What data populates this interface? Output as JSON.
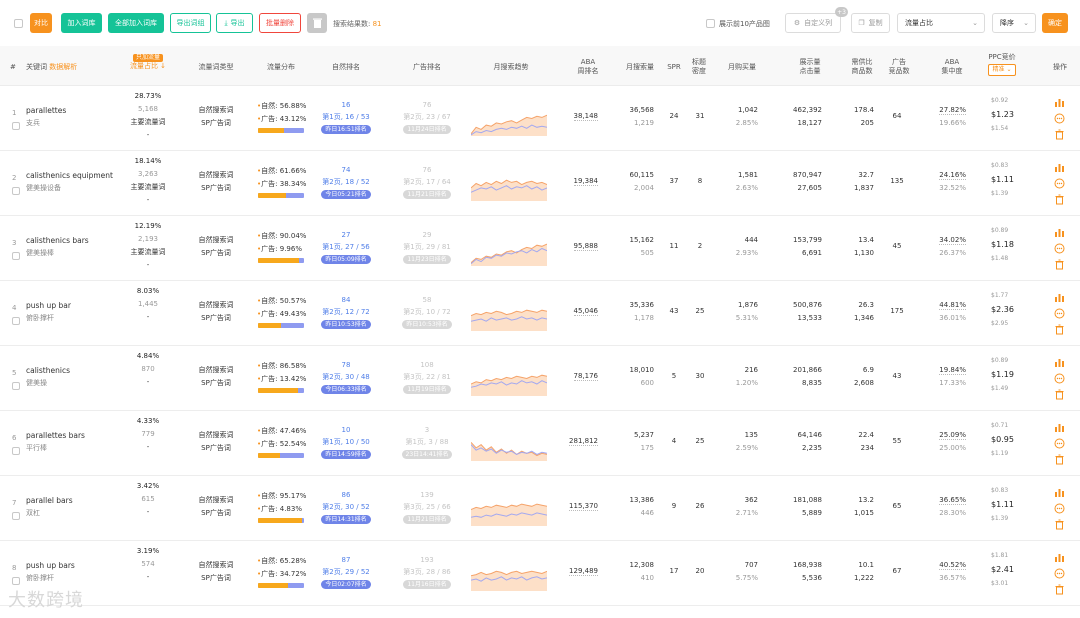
{
  "toolbar": {
    "compare": "对比",
    "add_lib": "加入词库",
    "add_all": "全部加入词库",
    "export_kw": "导出词组",
    "export": "导出",
    "batch_delete": "批量删除",
    "result_label": "搜索结果数:",
    "result_count": "81",
    "show_top10": "展示前10产品图",
    "custom_col": "自定义列",
    "custom_col_badge": "+3",
    "copy": "复制",
    "sort_field": "流量占比",
    "sort_order": "降序",
    "confirm": "确定"
  },
  "header": {
    "index": "#",
    "keyword": "关键词",
    "data_interpret": "数据解析",
    "traffic_share_tag": "只加流量",
    "traffic_share": "流量占比 ↓",
    "word_type": "流量词类型",
    "dist": "流量分布",
    "organic_rank": "自然排名",
    "ad_rank": "广告排名",
    "trend": "月搜索趋势",
    "aba1": "ABA",
    "aba2": "周排名",
    "monthly_search": "月搜索量",
    "spr": "SPR",
    "title_density1": "标题",
    "title_density2": "密度",
    "monthly_buy": "月购买量",
    "impressions1": "展示量",
    "impressions2": "点击量",
    "supply1": "需供比",
    "supply2": "商品数",
    "ad_products1": "广告",
    "ad_products2": "竞品数",
    "aba_conc1": "ABA",
    "aba_conc2": "集中度",
    "ppc": "PPC竞价",
    "ppc_sort": "精准",
    "actions": "操作"
  },
  "labels": {
    "organic": "自然:",
    "ad": "广告:",
    "word_type_1": "自然搜索词",
    "word_type_2": "SP广告词"
  },
  "colors": {
    "orange": "#f7921e",
    "green": "#15c397",
    "red": "#f0463c",
    "blue": "#4f7ee8",
    "purple_bar": "#8f9bf0"
  },
  "rows": [
    {
      "n": "1",
      "kw": "parallettes",
      "kw_cn": "支兵",
      "share": "28.73%",
      "share_cnt": "5,168",
      "share_type": "主要流量词",
      "share_dash": "-",
      "org_pct": "56.88%",
      "ad_pct": "43.12%",
      "org_frac": 0.5688,
      "org_rank": "16",
      "org_page": "第1页, 16 / 53",
      "org_pill": "昨日16:51排名",
      "ad_rank": "76",
      "ad_page": "第2页, 23 / 67",
      "ad_pill": "11月24日排名",
      "aba": "38,148",
      "ms": "36,568",
      "ms2": "1,219",
      "spr": "24",
      "td": "31",
      "mb": "1,042",
      "mb2": "2.85%",
      "imp": "462,392",
      "clk": "18,127",
      "sup": "178.4",
      "sup2": "205",
      "adp": "64",
      "conc": "27.82%",
      "conc2": "19.66%",
      "ppc_lo": "$0.92",
      "ppc": "$1.23",
      "ppc_hi": "$1.54",
      "trend_a": [
        60,
        48,
        52,
        44,
        46,
        40,
        42,
        38,
        36,
        40,
        35,
        30,
        32,
        28,
        30,
        26
      ],
      "trend_b": [
        62,
        56,
        58,
        54,
        56,
        52,
        50,
        52,
        48,
        50,
        46,
        50,
        44,
        48,
        46,
        48
      ]
    },
    {
      "n": "2",
      "kw": "calisthenics equipment",
      "kw_cn": "健美操设备",
      "share": "18.14%",
      "share_cnt": "3,263",
      "share_type": "主要流量词",
      "share_dash": "-",
      "org_pct": "61.66%",
      "ad_pct": "38.34%",
      "org_frac": 0.6166,
      "org_rank": "74",
      "org_page": "第2页, 18 / 52",
      "org_pill": "今日05:21排名",
      "ad_rank": "76",
      "ad_page": "第2页, 17 / 64",
      "ad_pill": "11月21日排名",
      "aba": "19,384",
      "ms": "60,115",
      "ms2": "2,004",
      "spr": "37",
      "td": "8",
      "mb": "1,581",
      "mb2": "2.63%",
      "imp": "870,947",
      "clk": "27,605",
      "sup": "32.7",
      "sup2": "1,837",
      "adp": "135",
      "conc": "24.16%",
      "conc2": "32.52%",
      "ppc_lo": "$0.83",
      "ppc": "$1.11",
      "ppc_hi": "$1.39",
      "trend_a": [
        40,
        32,
        36,
        30,
        34,
        28,
        32,
        26,
        30,
        28,
        34,
        30,
        28,
        32,
        30,
        34
      ],
      "trend_b": [
        48,
        44,
        40,
        42,
        38,
        44,
        40,
        36,
        42,
        38,
        40,
        36,
        42,
        38,
        44,
        40
      ]
    },
    {
      "n": "3",
      "kw": "calisthenics bars",
      "kw_cn": "健美操棒",
      "share": "12.19%",
      "share_cnt": "2,193",
      "share_type": "主要流量词",
      "share_dash": "-",
      "org_pct": "90.04%",
      "ad_pct": "9.96%",
      "org_frac": 0.9004,
      "org_rank": "27",
      "org_page": "第1页, 27 / 56",
      "org_pill": "昨日05:09排名",
      "ad_rank": "29",
      "ad_page": "第1页, 29 / 81",
      "ad_pill": "11月23日排名",
      "aba": "95,888",
      "ms": "15,162",
      "ms2": "505",
      "spr": "11",
      "td": "2",
      "mb": "444",
      "mb2": "2.93%",
      "imp": "153,799",
      "clk": "6,691",
      "sup": "13.4",
      "sup2": "1,130",
      "adp": "45",
      "conc": "34.02%",
      "conc2": "26.37%",
      "ppc_lo": "$0.89",
      "ppc": "$1.18",
      "ppc_hi": "$1.48",
      "trend_a": [
        58,
        50,
        52,
        46,
        48,
        42,
        44,
        38,
        36,
        40,
        34,
        30,
        32,
        26,
        28,
        24
      ],
      "trend_b": [
        60,
        52,
        56,
        48,
        50,
        44,
        46,
        40,
        42,
        38,
        36,
        40,
        34,
        38,
        32,
        36
      ]
    },
    {
      "n": "4",
      "kw": "push up bar",
      "kw_cn": "俯卧撑杆",
      "share": "8.03%",
      "share_cnt": "1,445",
      "share_type": "-",
      "share_dash": "",
      "org_pct": "50.57%",
      "ad_pct": "49.43%",
      "org_frac": 0.5057,
      "org_rank": "84",
      "org_page": "第2页, 12 / 72",
      "org_pill": "昨日10:53排名",
      "ad_rank": "58",
      "ad_page": "第2页, 10 / 72",
      "ad_pill": "昨日10:53排名",
      "aba": "45,046",
      "ms": "35,336",
      "ms2": "1,178",
      "spr": "43",
      "td": "25",
      "mb": "1,876",
      "mb2": "5.31%",
      "imp": "500,876",
      "clk": "13,533",
      "sup": "26.3",
      "sup2": "1,346",
      "adp": "175",
      "conc": "44.81%",
      "conc2": "36.01%",
      "ppc_lo": "$1.77",
      "ppc": "$2.36",
      "ppc_hi": "$2.95",
      "trend_a": [
        36,
        32,
        34,
        30,
        32,
        28,
        30,
        34,
        32,
        28,
        30,
        26,
        28,
        30,
        26,
        28
      ],
      "trend_b": [
        46,
        44,
        42,
        46,
        40,
        44,
        42,
        40,
        44,
        42,
        38,
        42,
        40,
        44,
        40,
        42
      ]
    },
    {
      "n": "5",
      "kw": "calisthenics",
      "kw_cn": "健美操",
      "share": "4.84%",
      "share_cnt": "870",
      "share_type": "-",
      "share_dash": "",
      "org_pct": "86.58%",
      "ad_pct": "13.42%",
      "org_frac": 0.8658,
      "org_rank": "78",
      "org_page": "第2页, 30 / 48",
      "org_pill": "今日06:33排名",
      "ad_rank": "108",
      "ad_page": "第3页, 22 / 81",
      "ad_pill": "11月19日排名",
      "aba": "78,176",
      "ms": "18,010",
      "ms2": "600",
      "spr": "5",
      "td": "30",
      "mb": "216",
      "mb2": "1.20%",
      "imp": "201,866",
      "clk": "8,835",
      "sup": "6.9",
      "sup2": "2,608",
      "adp": "43",
      "conc": "19.84%",
      "conc2": "17.33%",
      "ppc_lo": "$0.89",
      "ppc": "$1.19",
      "ppc_hi": "$1.49",
      "trend_a": [
        42,
        38,
        40,
        34,
        36,
        32,
        34,
        30,
        32,
        28,
        30,
        32,
        28,
        30,
        26,
        28
      ],
      "trend_b": [
        48,
        46,
        42,
        44,
        40,
        42,
        38,
        44,
        40,
        42,
        36,
        40,
        38,
        42,
        36,
        40
      ]
    },
    {
      "n": "6",
      "kw": "parallettes bars",
      "kw_cn": "平行棒",
      "share": "4.33%",
      "share_cnt": "779",
      "share_type": "-",
      "share_dash": "",
      "org_pct": "47.46%",
      "ad_pct": "52.54%",
      "org_frac": 0.4746,
      "org_rank": "10",
      "org_page": "第1页, 10 / 50",
      "org_pill": "昨日14:59排名",
      "ad_rank": "3",
      "ad_page": "第1页, 3 / 88",
      "ad_pill": "23日14:41排名",
      "aba": "281,812",
      "ms": "5,237",
      "ms2": "175",
      "spr": "4",
      "td": "25",
      "mb": "135",
      "mb2": "2.59%",
      "imp": "64,146",
      "clk": "2,235",
      "sup": "22.4",
      "sup2": "234",
      "adp": "55",
      "conc": "25.09%",
      "conc2": "25.00%",
      "ppc_lo": "$0.71",
      "ppc": "$0.95",
      "ppc_hi": "$1.19",
      "trend_a": [
        30,
        40,
        34,
        44,
        38,
        48,
        42,
        50,
        44,
        52,
        46,
        50,
        48,
        54,
        50,
        52
      ],
      "trend_b": [
        34,
        44,
        40,
        46,
        42,
        50,
        44,
        48,
        46,
        52,
        48,
        50,
        46,
        52,
        48,
        50
      ]
    },
    {
      "n": "7",
      "kw": "parallel bars",
      "kw_cn": "双杠",
      "share": "3.42%",
      "share_cnt": "615",
      "share_type": "-",
      "share_dash": "",
      "org_pct": "95.17%",
      "ad_pct": "4.83%",
      "org_frac": 0.9517,
      "org_rank": "86",
      "org_page": "第2页, 30 / 52",
      "org_pill": "昨日14:31排名",
      "ad_rank": "139",
      "ad_page": "第3页, 25 / 66",
      "ad_pill": "11月21日排名",
      "aba": "115,370",
      "ms": "13,386",
      "ms2": "446",
      "spr": "9",
      "td": "26",
      "mb": "362",
      "mb2": "2.71%",
      "imp": "181,088",
      "clk": "5,889",
      "sup": "13.2",
      "sup2": "1,015",
      "adp": "65",
      "conc": "36.65%",
      "conc2": "28.30%",
      "ppc_lo": "$0.83",
      "ppc": "$1.11",
      "ppc_hi": "$1.39",
      "trend_a": [
        34,
        30,
        32,
        28,
        30,
        26,
        28,
        30,
        26,
        28,
        24,
        26,
        28,
        24,
        26,
        28
      ],
      "trend_b": [
        48,
        46,
        48,
        44,
        46,
        42,
        44,
        46,
        42,
        44,
        40,
        42,
        44,
        40,
        42,
        44
      ]
    },
    {
      "n": "8",
      "kw": "push up bars",
      "kw_cn": "俯卧撑杆",
      "share": "3.19%",
      "share_cnt": "574",
      "share_type": "-",
      "share_dash": "",
      "org_pct": "65.28%",
      "ad_pct": "34.72%",
      "org_frac": 0.6528,
      "org_rank": "87",
      "org_page": "第2页, 29 / 52",
      "org_pill": "今日02:07排名",
      "ad_rank": "193",
      "ad_page": "第3页, 28 / 86",
      "ad_pill": "11月16日排名",
      "aba": "129,489",
      "ms": "12,308",
      "ms2": "410",
      "spr": "17",
      "td": "20",
      "mb": "707",
      "mb2": "5.75%",
      "imp": "168,938",
      "clk": "5,536",
      "sup": "10.1",
      "sup2": "1,222",
      "adp": "67",
      "conc": "40.52%",
      "conc2": "36.57%",
      "ppc_lo": "$1.81",
      "ppc": "$2.41",
      "ppc_hi": "$3.01",
      "trend_a": [
        36,
        34,
        30,
        34,
        32,
        28,
        30,
        34,
        30,
        28,
        32,
        30,
        28,
        30,
        32,
        28
      ],
      "trend_b": [
        44,
        42,
        46,
        40,
        44,
        42,
        38,
        44,
        40,
        42,
        38,
        44,
        40,
        38,
        42,
        40
      ]
    }
  ],
  "watermark": "大数跨境"
}
